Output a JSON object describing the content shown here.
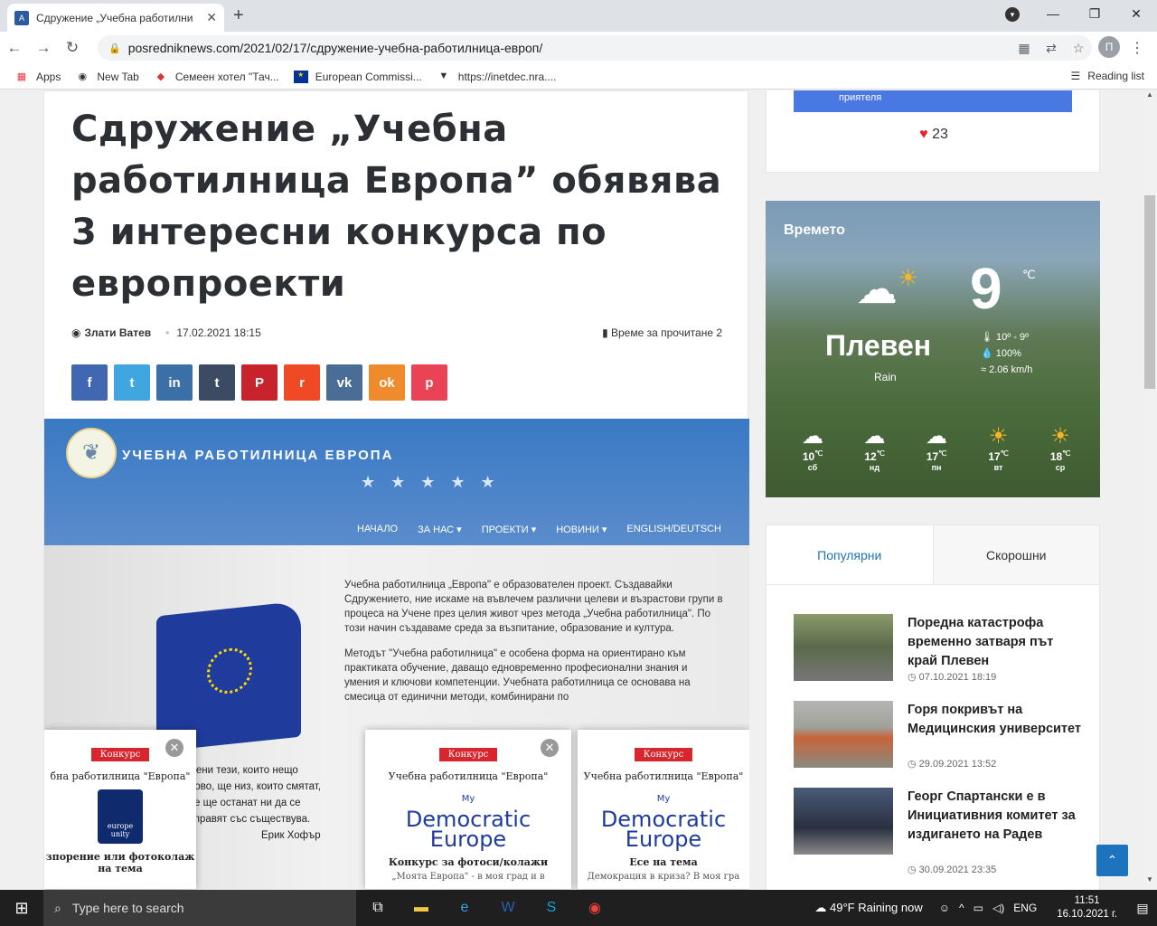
{
  "browser": {
    "tab_title": "Сдружение „Учебна работилни",
    "tab_close": "✕",
    "new_tab": "+",
    "url": "posredniknews.com/2021/02/17/сдружение-учебна-работилница-европ/",
    "profile_letter": "П",
    "bookmarks": [
      {
        "label": "Apps",
        "icon": "apps-grid-icon"
      },
      {
        "label": "New Tab",
        "icon": "globe-icon"
      },
      {
        "label": "Семеен хотел \"Тач...",
        "icon": "map-pin-icon"
      },
      {
        "label": "European Commissi...",
        "icon": "eu-flag-icon"
      },
      {
        "label": "https://inetdec.nra....",
        "icon": "nra-icon"
      }
    ],
    "reading_list": "Reading list"
  },
  "article": {
    "title": "Сдружение „Учебна работилница Европа” обявява 3 интересни конкурса по европроекти",
    "author": "Злати Ватев",
    "date": "17.02.2021 18:15",
    "reading_time": "Време за прочитане 2",
    "share_buttons": [
      {
        "name": "facebook",
        "glyph": "f",
        "color": "#4267b2"
      },
      {
        "name": "twitter",
        "glyph": "t",
        "color": "#40a6e0"
      },
      {
        "name": "linkedin",
        "glyph": "in",
        "color": "#3a6fa8"
      },
      {
        "name": "tumblr",
        "glyph": "t",
        "color": "#3b4b63"
      },
      {
        "name": "pinterest",
        "glyph": "P",
        "color": "#c8232c"
      },
      {
        "name": "reddit",
        "glyph": "r",
        "color": "#ef4a25"
      },
      {
        "name": "vk",
        "glyph": "vk",
        "color": "#4a6d96"
      },
      {
        "name": "odnoklassniki",
        "glyph": "ok",
        "color": "#ef8b2c"
      },
      {
        "name": "pocket",
        "glyph": "p",
        "color": "#e94355"
      }
    ],
    "hero": {
      "logo_text": "УЧЕБНА РАБОТИЛНИЦА ЕВРОПА",
      "menu": [
        "НАЧАЛО",
        "ЗА НАС ▾",
        "ПРОЕКТИ ▾",
        "НОВИНИ ▾",
        "ENGLISH/DEUTSCH"
      ],
      "para1": "Учебна работилница „Европа\" е образователен проект. Създавайки Сдружението, ние искаме на въвлечем различни целеви и възрастови групи в процеса на Учене през целия живот чрез метода „Учебна работилница\". По този начин създаваме среда за възпитание, образование и култура.",
      "para2": "Методът \"Учебна работилница\" е особена форма на ориентирано към практиката обучение, даващо едновременно професионални знания и умения и ключови компетенции. Учебната работилница се основава на смесица от единични методи, комбинирани по",
      "under_text": "мени тези, които нещо ново, ще низ, които смятат, че ще останат ни да се справят със съществува.",
      "quote_author": "Ерик Хофър",
      "cards": [
        {
          "badge": "Конкурс",
          "sub": "бна работилница \"Европа\"",
          "logo_text": "europe unity",
          "foot": "зпорение или фотоколаж на тема",
          "foot2": "",
          "close": "✕"
        },
        {
          "badge": "Конкурс",
          "sub": "Учебна работилница \"Европа\"",
          "logo_my": "My",
          "logo_text": "Democratic Europe",
          "foot": "Конкурс за фотоси/колажи",
          "foot2": "„Моята Европа\" - в моя град и в",
          "close": "✕"
        },
        {
          "badge": "Конкурс",
          "sub": "Учебна работилница \"Европа\"",
          "logo_my": "My",
          "logo_text": "Democratic Europe",
          "foot": "Есе на тема",
          "foot2": "Демокрация в криза? В моя гра"
        }
      ]
    }
  },
  "sidebar": {
    "fb_button": "приятеля",
    "likes": "23",
    "weather": {
      "title": "Времето",
      "temp": "9",
      "unit": "℃",
      "city": "Плевен",
      "condition": "Rain",
      "range": "10º - 9º",
      "humidity": "100%",
      "wind": "2.06 km/h",
      "days": [
        {
          "temp": "10",
          "name": "сб",
          "icon": "moon-cloud-icon"
        },
        {
          "temp": "12",
          "name": "нд",
          "icon": "sun-cloud-icon"
        },
        {
          "temp": "17",
          "name": "пн",
          "icon": "cloud-icon"
        },
        {
          "temp": "17",
          "name": "вт",
          "icon": "sun-icon"
        },
        {
          "temp": "18",
          "name": "ср",
          "icon": "sun-icon"
        }
      ],
      "day_unit": "℃"
    },
    "tabs": [
      "Популярни",
      "Скорошни"
    ],
    "posts": [
      {
        "title": "Поредна катастрофа временно затваря път край Плевен",
        "date": "07.10.2021 18:19"
      },
      {
        "title": "Горя покривът на Медицинския университет",
        "date": "29.09.2021 13:52"
      },
      {
        "title": "Георг Спартански е в Инициативния комитет за издигането на Радев",
        "date": "30.09.2021 23:35"
      }
    ]
  },
  "taskbar": {
    "search_placeholder": "Type here to search",
    "weather": "49°F  Raining now",
    "lang": "ENG",
    "time": "11:51",
    "date": "16.10.2021 г."
  }
}
